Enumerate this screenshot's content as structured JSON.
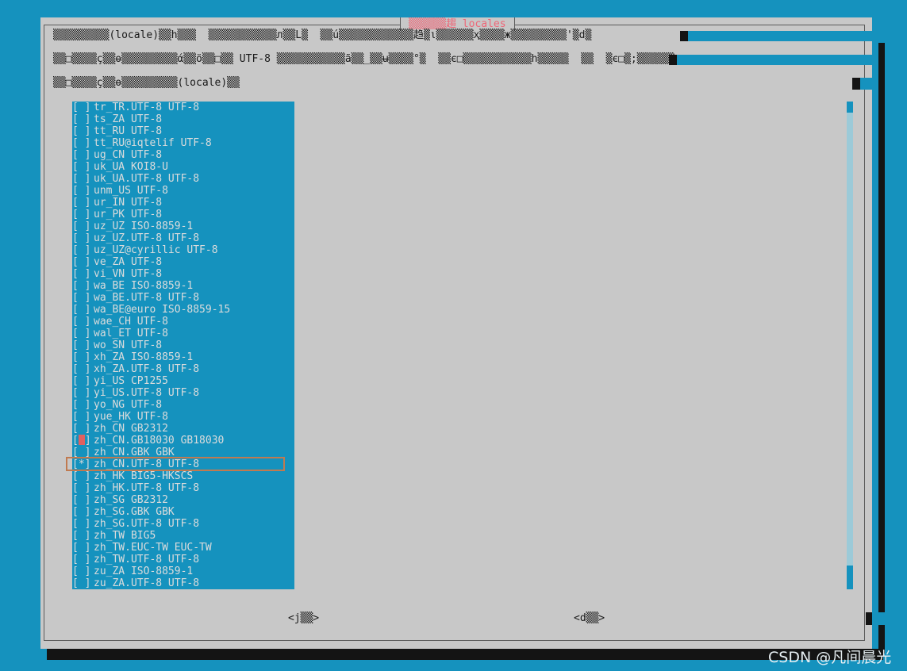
{
  "dialog": {
    "title": "▒▒▒▒▒▒趨 locales",
    "message_lines": [
      "▒▒▒▒▒▒▒▒▒(locale)▒▒h▒▒▒  ▒▒▒▒▒▒▒▒▒▒▒л▒▒L▒  ▒▒ú▒▒▒▒▒▒▒▒▒▒▒▒趋▒ι▒▒▒▒▒▒ҳ▒▒▒▒ж▒▒▒▒▒▒▒▒▒'▒d▒",
      "▒▒□▒▒▒▒ç▒▒ө▒▒▒▒▒▒▒▒▒ά▒▒ö▒▒□▒▒ UTF-8 ▒▒▒▒▒▒▒▒▒▒▒ã▒▒_▒▒ʉ▒▒▒▒°▒  ▒▒є□▒▒▒▒▒▒▒▒▒▒▒h▒▒▒▒▒  ▒▒  ▒є□▒;▒▒▒▒▒▒",
      "▒▒□▒▒▒▒ç▒▒ө▒▒▒▒▒▒▒▒▒(locale)▒▒"
    ]
  },
  "locales": [
    {
      "mark": "[ ]",
      "label": "tr_TR.UTF-8 UTF-8"
    },
    {
      "mark": "[ ]",
      "label": "ts_ZA UTF-8"
    },
    {
      "mark": "[ ]",
      "label": "tt_RU UTF-8"
    },
    {
      "mark": "[ ]",
      "label": "tt_RU@iqtelif UTF-8"
    },
    {
      "mark": "[ ]",
      "label": "ug_CN UTF-8"
    },
    {
      "mark": "[ ]",
      "label": "uk_UA KOI8-U"
    },
    {
      "mark": "[ ]",
      "label": "uk_UA.UTF-8 UTF-8"
    },
    {
      "mark": "[ ]",
      "label": "unm_US UTF-8"
    },
    {
      "mark": "[ ]",
      "label": "ur_IN UTF-8"
    },
    {
      "mark": "[ ]",
      "label": "ur_PK UTF-8"
    },
    {
      "mark": "[ ]",
      "label": "uz_UZ ISO-8859-1"
    },
    {
      "mark": "[ ]",
      "label": "uz_UZ.UTF-8 UTF-8"
    },
    {
      "mark": "[ ]",
      "label": "uz_UZ@cyrillic UTF-8"
    },
    {
      "mark": "[ ]",
      "label": "ve_ZA UTF-8"
    },
    {
      "mark": "[ ]",
      "label": "vi_VN UTF-8"
    },
    {
      "mark": "[ ]",
      "label": "wa_BE ISO-8859-1"
    },
    {
      "mark": "[ ]",
      "label": "wa_BE.UTF-8 UTF-8"
    },
    {
      "mark": "[ ]",
      "label": "wa_BE@euro ISO-8859-15"
    },
    {
      "mark": "[ ]",
      "label": "wae_CH UTF-8"
    },
    {
      "mark": "[ ]",
      "label": "wal_ET UTF-8"
    },
    {
      "mark": "[ ]",
      "label": "wo_SN UTF-8"
    },
    {
      "mark": "[ ]",
      "label": "xh_ZA ISO-8859-1"
    },
    {
      "mark": "[ ]",
      "label": "xh_ZA.UTF-8 UTF-8"
    },
    {
      "mark": "[ ]",
      "label": "yi_US CP1255"
    },
    {
      "mark": "[ ]",
      "label": "yi_US.UTF-8 UTF-8"
    },
    {
      "mark": "[ ]",
      "label": "yo_NG UTF-8"
    },
    {
      "mark": "[ ]",
      "label": "yue_HK UTF-8"
    },
    {
      "mark": "[ ]",
      "label": "zh_CN GB2312"
    },
    {
      "mark": "[ ]",
      "label": "zh_CN.GB18030 GB18030",
      "cursor": true
    },
    {
      "mark": "[ ]",
      "label": "zh_CN.GBK GBK"
    },
    {
      "mark": "[*]",
      "label": "zh_CN.UTF-8 UTF-8",
      "highlighted": true
    },
    {
      "mark": "[ ]",
      "label": "zh_HK BIG5-HKSCS"
    },
    {
      "mark": "[ ]",
      "label": "zh_HK.UTF-8 UTF-8"
    },
    {
      "mark": "[ ]",
      "label": "zh_SG GB2312"
    },
    {
      "mark": "[ ]",
      "label": "zh_SG.GBK GBK"
    },
    {
      "mark": "[ ]",
      "label": "zh_SG.UTF-8 UTF-8"
    },
    {
      "mark": "[ ]",
      "label": "zh_TW BIG5"
    },
    {
      "mark": "[ ]",
      "label": "zh_TW.EUC-TW EUC-TW"
    },
    {
      "mark": "[ ]",
      "label": "zh_TW.UTF-8 UTF-8"
    },
    {
      "mark": "[ ]",
      "label": "zu_ZA ISO-8859-1"
    },
    {
      "mark": "[ ]",
      "label": "zu_ZA.UTF-8 UTF-8"
    }
  ],
  "buttons": {
    "ok_label": "<j▒▒>",
    "cancel_label": "<d▒▒>"
  },
  "watermark": "CSDN @凡间晨光",
  "colors": {
    "terminal_blue": "#1592be",
    "dialog_gray": "#c8c8c8",
    "title_red": "#ee6677",
    "cursor_red": "#e06060",
    "highlight_box": "#c07a50"
  }
}
